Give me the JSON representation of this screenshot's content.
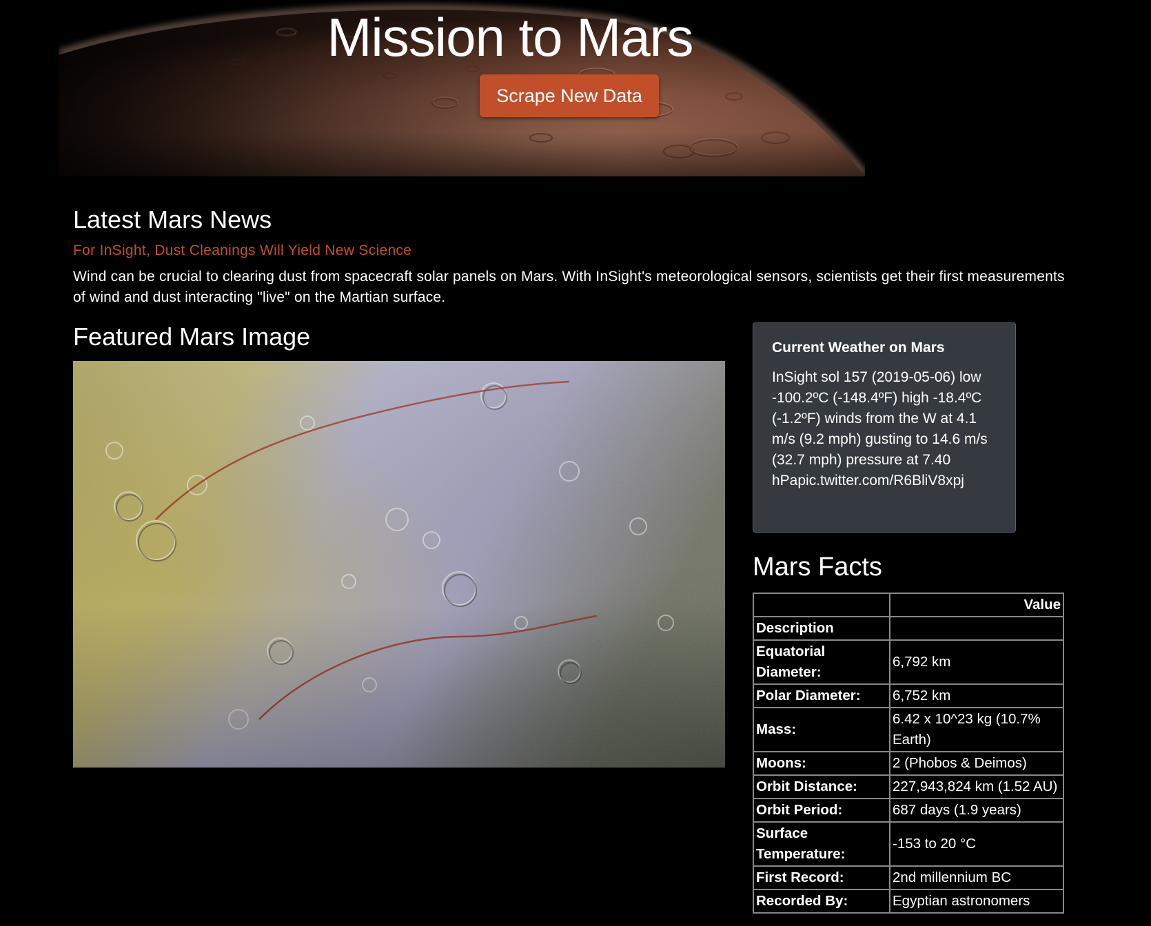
{
  "header": {
    "title": "Mission to Mars",
    "button_label": "Scrape New Data"
  },
  "news": {
    "heading": "Latest Mars News",
    "title": "For InSight, Dust Cleanings Will Yield New Science",
    "paragraph": "Wind can be crucial to clearing dust from spacecraft solar panels on Mars. With InSight's meteorological sensors, scientists get their first measurements of wind and dust interacting \"live\" on the Martian surface."
  },
  "featured": {
    "heading": "Featured Mars Image"
  },
  "weather": {
    "title": "Current Weather on Mars",
    "text": "InSight sol 157 (2019-05-06) low -100.2ºC (-148.4ºF) high -18.4ºC (-1.2ºF) winds from the W at 4.1 m/s (9.2 mph) gusting to 14.6 m/s (32.7 mph) pressure at 7.40 hPapic.twitter.com/R6BliV8xpj"
  },
  "facts": {
    "heading": "Mars Facts",
    "header_row": [
      "",
      "Value"
    ],
    "index_label": "Description",
    "rows": [
      {
        "label": "Equatorial Diameter:",
        "value": "6,792 km"
      },
      {
        "label": "Polar Diameter:",
        "value": "6,752 km"
      },
      {
        "label": "Mass:",
        "value": "6.42 x 10^23 kg (10.7% Earth)"
      },
      {
        "label": "Moons:",
        "value": "2 (Phobos & Deimos)"
      },
      {
        "label": "Orbit Distance:",
        "value": "227,943,824 km (1.52 AU)"
      },
      {
        "label": "Orbit Period:",
        "value": "687 days (1.9 years)"
      },
      {
        "label": "Surface Temperature:",
        "value": "-153 to 20 °C"
      },
      {
        "label": "First Record:",
        "value": "2nd millennium BC"
      },
      {
        "label": "Recorded By:",
        "value": "Egyptian astronomers"
      }
    ]
  }
}
